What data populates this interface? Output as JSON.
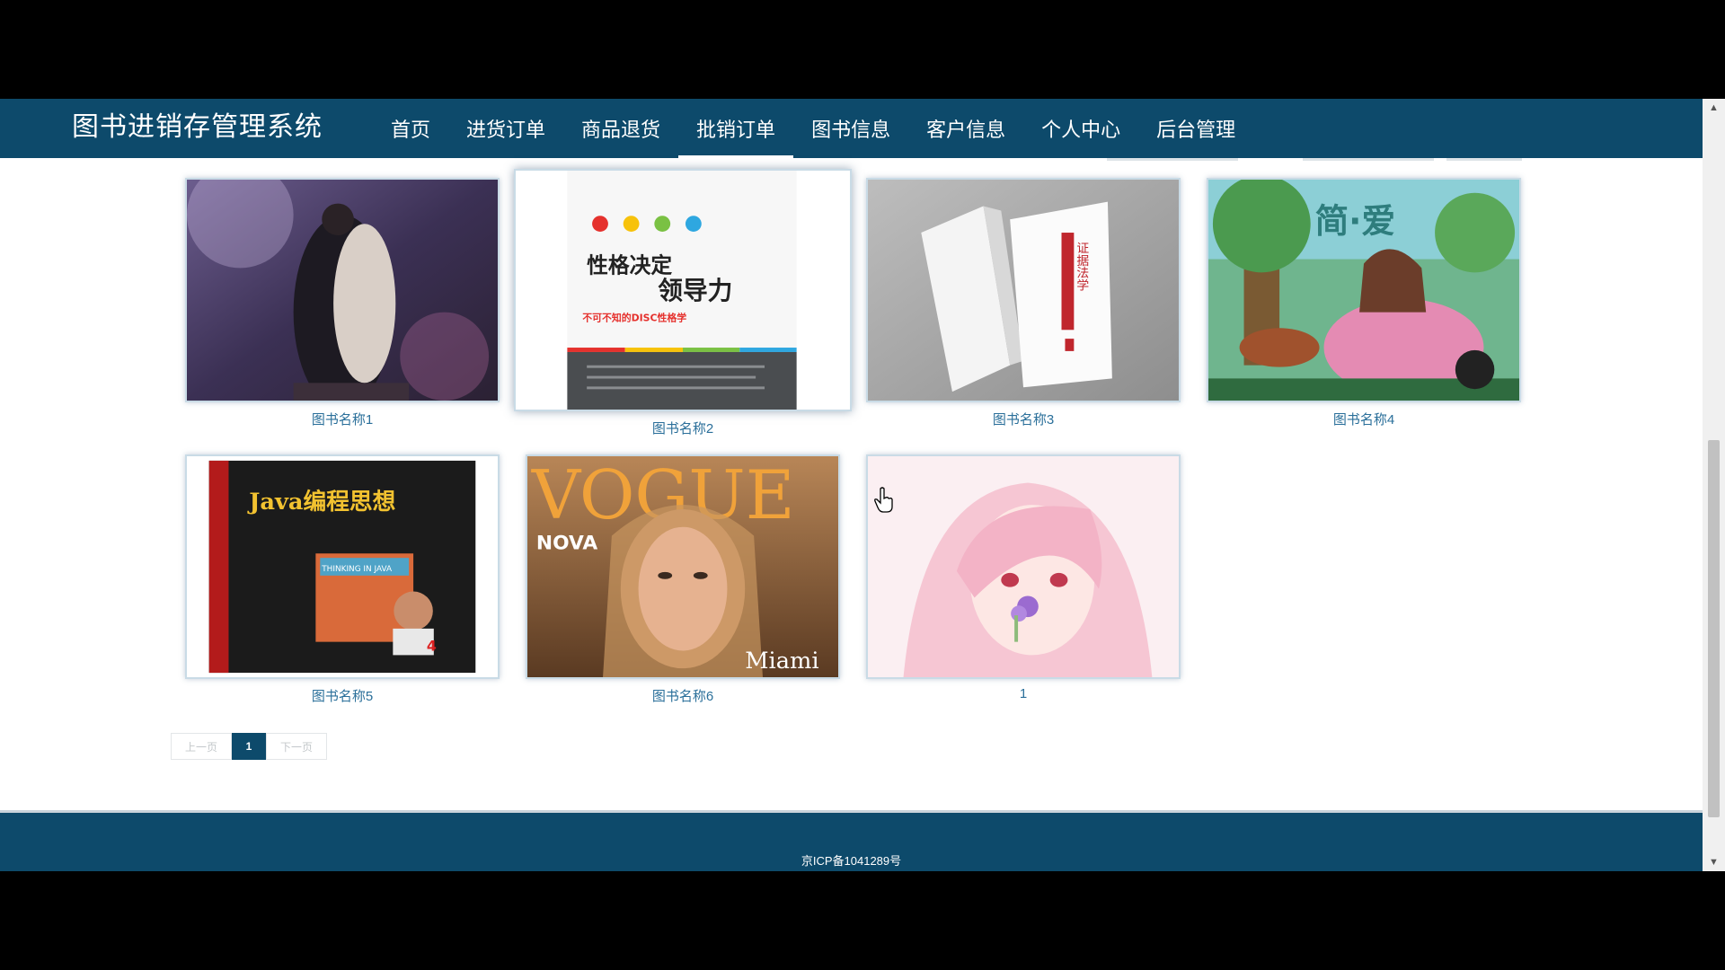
{
  "header": {
    "brand": "图书进销存管理系统",
    "nav": [
      {
        "label": "首页"
      },
      {
        "label": "进货订单"
      },
      {
        "label": "商品退货"
      },
      {
        "label": "批销订单"
      },
      {
        "label": "图书信息"
      },
      {
        "label": "客户信息"
      },
      {
        "label": "个人中心"
      },
      {
        "label": "后台管理"
      }
    ],
    "active_index": 3
  },
  "books": [
    {
      "caption": "图书名称1",
      "cover": "couple-night-photo"
    },
    {
      "caption": "图书名称2",
      "cover": "leadership-book-cover",
      "cover_title": "性格决定",
      "cover_title2": "领导力",
      "cover_subtitle": "不可不知的DISC性格学"
    },
    {
      "caption": "图书名称3",
      "cover": "law-book-photo",
      "cover_spine": "证据法学"
    },
    {
      "caption": "图书名称4",
      "cover": "jane-eyre-illustration",
      "cover_title": "简·爱"
    },
    {
      "caption": "图书名称5",
      "cover": "java-book-cover",
      "cover_title": "Java编程思想",
      "cover_sub": "THINKING IN JAVA"
    },
    {
      "caption": "图书名称6",
      "cover": "vogue-magazine-cover",
      "cover_title": "VOGUE",
      "cover_city": "Miami"
    },
    {
      "caption": "1",
      "cover": "anime-girl-illustration"
    }
  ],
  "pagination": {
    "prev": "上一页",
    "current": "1",
    "next": "下一页"
  },
  "footer": {
    "icp": "京ICP备1041289号"
  },
  "colors": {
    "brand": "#0d4a6b",
    "caption": "#2a6f9a"
  }
}
